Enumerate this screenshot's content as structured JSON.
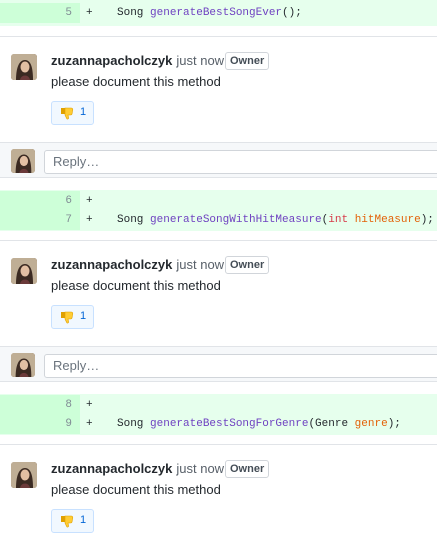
{
  "comment": {
    "author": "zuzannapacholczyk",
    "timestamp": "just now",
    "badge": "Owner",
    "body": "please document this method",
    "reaction_count": "1"
  },
  "reply": {
    "placeholder": "Reply…"
  },
  "diff_lines": [
    {
      "num": "5",
      "sign": "+"
    },
    {
      "num": "6",
      "sign": "+"
    },
    {
      "num": "7",
      "sign": "+"
    },
    {
      "num": "8",
      "sign": "+"
    },
    {
      "num": "9",
      "sign": "+"
    }
  ],
  "code": {
    "line5": {
      "type": "Song ",
      "fn": "generateBestSongEver",
      "rest": "();"
    },
    "line7": {
      "type": "Song ",
      "fn": "generateSongWithHitMeasure",
      "open": "(",
      "kw": "int",
      "sp": " ",
      "param": "hitMeasure",
      "close": ");"
    },
    "line9": {
      "type": "Song ",
      "fn": "generateBestSongForGenre",
      "open": "(Genre ",
      "param": "genre",
      "close": ");"
    }
  },
  "colors": {
    "added_bg": "#e6ffed",
    "added_gutter": "#cdffd8",
    "reaction_bg": "#f1f8ff",
    "link": "#0366d6"
  },
  "icons": {
    "reaction": "thumbs-down-emoji",
    "avatar": "user-avatar"
  }
}
